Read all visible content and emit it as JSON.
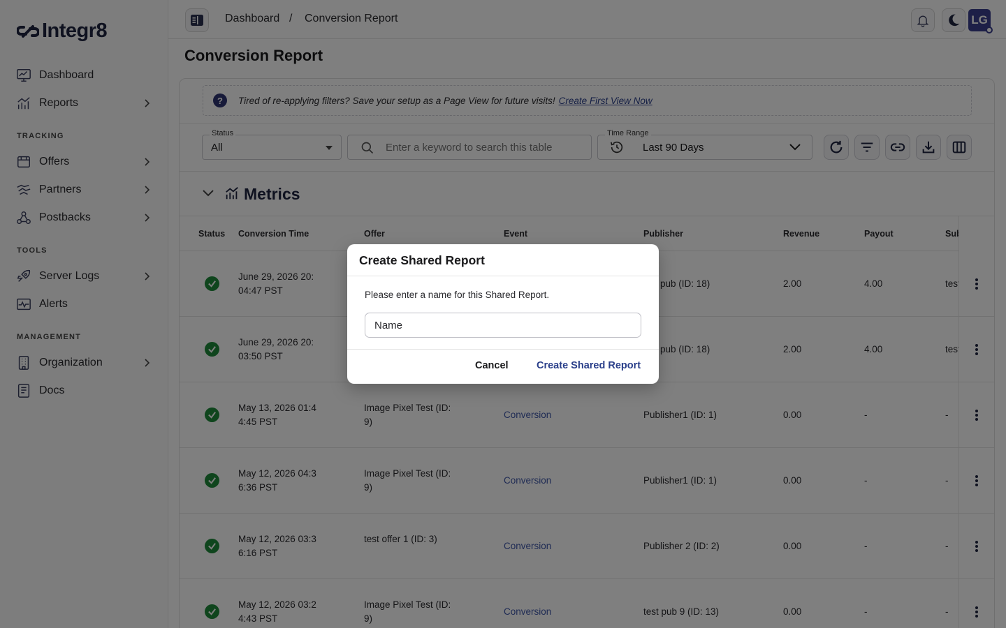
{
  "app": {
    "name": "Integr8"
  },
  "sidebar": {
    "items": [
      {
        "label": "Dashboard",
        "icon": "dashboard-icon",
        "chevron": false
      },
      {
        "label": "Reports",
        "icon": "reports-icon",
        "chevron": true
      }
    ],
    "sections": [
      {
        "title": "TRACKING",
        "items": [
          {
            "label": "Offers",
            "icon": "offers-icon",
            "chevron": true
          },
          {
            "label": "Partners",
            "icon": "partners-icon",
            "chevron": true
          },
          {
            "label": "Postbacks",
            "icon": "postbacks-icon",
            "chevron": true
          }
        ]
      },
      {
        "title": "TOOLS",
        "items": [
          {
            "label": "Server Logs",
            "icon": "server-logs-icon",
            "chevron": true
          },
          {
            "label": "Alerts",
            "icon": "alerts-icon",
            "chevron": false
          }
        ]
      },
      {
        "title": "MANAGEMENT",
        "items": [
          {
            "label": "Organization",
            "icon": "organization-icon",
            "chevron": true
          },
          {
            "label": "Docs",
            "icon": "docs-icon",
            "chevron": false
          }
        ]
      }
    ]
  },
  "topbar": {
    "breadcrumb": [
      "Dashboard",
      "/",
      "Conversion Report"
    ],
    "avatar_initials": "LG"
  },
  "page": {
    "title": "Conversion Report",
    "tip": {
      "text": "Tired of re-applying filters? Save your setup as a Page View for future visits!",
      "link": "Create First View Now"
    },
    "filters": {
      "status_label": "Status",
      "status_value": "All",
      "search_placeholder": "Enter a keyword to search this table",
      "time_label": "Time Range",
      "time_value": "Last 90 Days"
    },
    "metrics_title": "Metrics"
  },
  "table": {
    "columns": [
      "Status",
      "Conversion Time",
      "Offer",
      "Event",
      "Publisher",
      "Revenue",
      "Payout",
      "Sub"
    ],
    "rows": [
      {
        "time1": "June 29, 2026 20:",
        "time2": "04:47 PST",
        "offer1": "",
        "offer2": "",
        "event": "",
        "publisher": "pub (ID: 18)",
        "revenue": "2.00",
        "payout": "4.00",
        "sub": "test"
      },
      {
        "time1": "June 29, 2026 20:",
        "time2": "03:50 PST",
        "offer1": "",
        "offer2": "",
        "event": "",
        "publisher": "pub (ID: 18)",
        "revenue": "2.00",
        "payout": "4.00",
        "sub": "test"
      },
      {
        "time1": "May 13, 2026 01:4",
        "time2": "4:45 PST",
        "offer1": "Image Pixel Test (ID:",
        "offer2": "9)",
        "event": "Conversion",
        "publisher": "Publisher1 (ID: 1)",
        "revenue": "0.00",
        "payout": "-",
        "sub": "-"
      },
      {
        "time1": "May 12, 2026 04:3",
        "time2": "6:36 PST",
        "offer1": "Image Pixel Test (ID:",
        "offer2": "9)",
        "event": "Conversion",
        "publisher": "Publisher1 (ID: 1)",
        "revenue": "0.00",
        "payout": "-",
        "sub": "-"
      },
      {
        "time1": "May 12, 2026 03:3",
        "time2": "6:16 PST",
        "offer1": "test offer 1 (ID: 3)",
        "offer2": "",
        "event": "Conversion",
        "publisher": "Publisher 2 (ID: 2)",
        "revenue": "0.00",
        "payout": "-",
        "sub": "-"
      },
      {
        "time1": "May 12, 2026 03:2",
        "time2": "4:43 PST",
        "offer1": "Image Pixel Test (ID:",
        "offer2": "9)",
        "event": "Conversion",
        "publisher": "test pub 9 (ID: 13)",
        "revenue": "0.00",
        "payout": "-",
        "sub": "-"
      }
    ]
  },
  "modal": {
    "title": "Create Shared Report",
    "prompt": "Please enter a name for this Shared Report.",
    "input_placeholder": "Name",
    "cancel_label": "Cancel",
    "submit_label": "Create Shared Report"
  },
  "colors": {
    "brand": "#1f2540",
    "accent": "#2a3f8a",
    "success": "#1f8a3a",
    "link": "#3e56a8"
  }
}
